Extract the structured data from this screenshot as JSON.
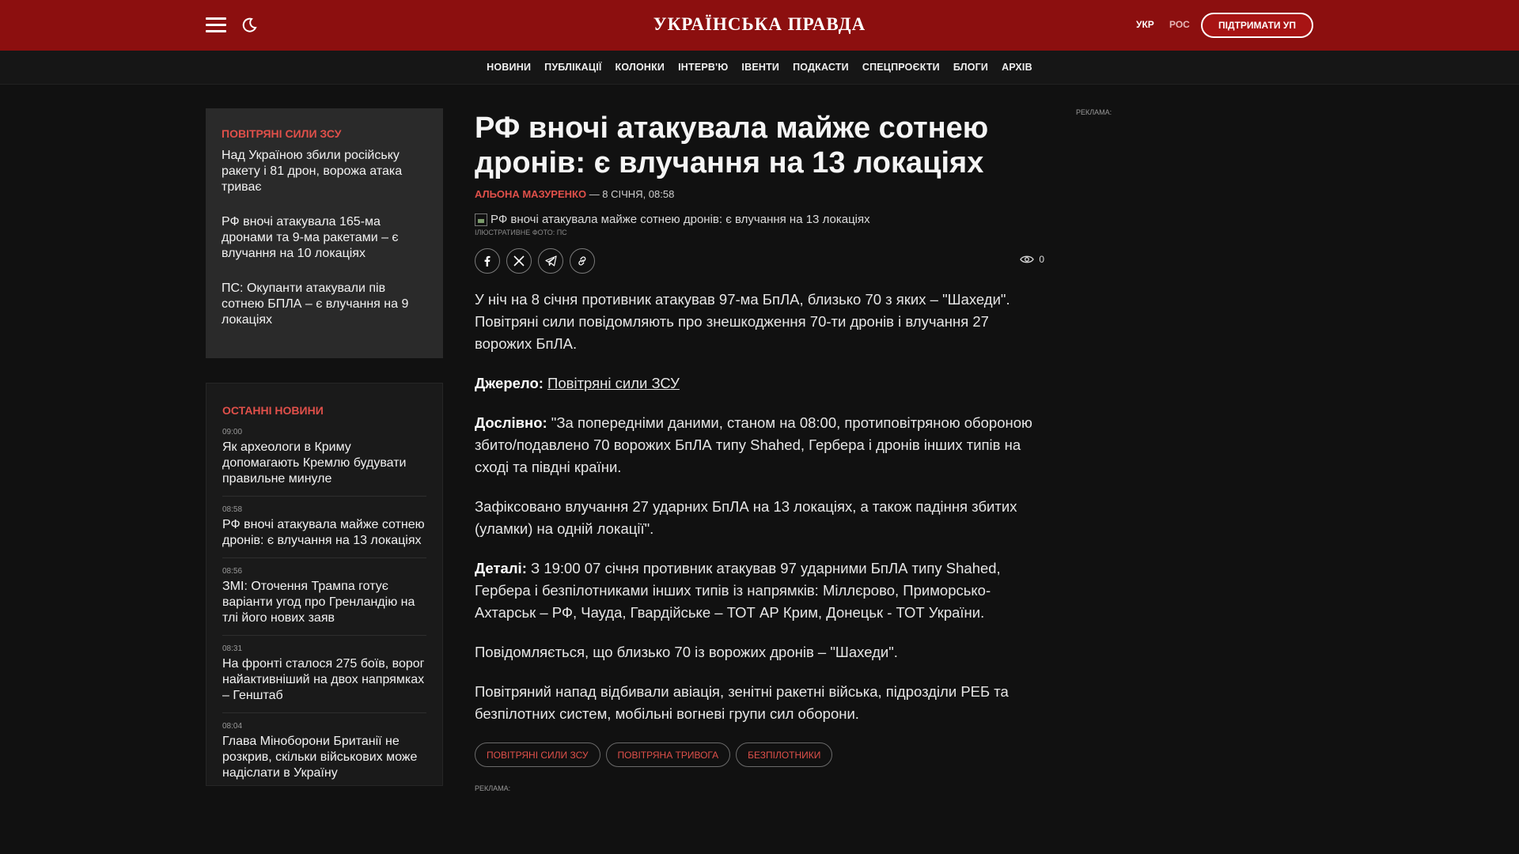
{
  "header": {
    "logo": "УКРАЇНСЬКА ПРАВДА",
    "lang_ukr": "УКР",
    "lang_ros": "РОС",
    "support": "ПІДТРИМАТИ УП"
  },
  "nav": [
    "НОВИНИ",
    "ПУБЛІКАЦІЇ",
    "КОЛОНКИ",
    "ІНТЕРВ'Ю",
    "ІВЕНТИ",
    "ПОДКАСТИ",
    "СПЕЦПРОЄКТИ",
    "БЛОГИ",
    "АРХІВ"
  ],
  "related": {
    "title": "ПОВІТРЯНІ СИЛИ ЗСУ",
    "items": [
      "Над Україною збили російську ракету і 81 дрон, ворожа атака триває",
      "РФ вночі атакувала 165-ма дронами та 9-ма ракетами – є влучання на 10 локаціях",
      "ПС: Окупанти атакували пів сотнею БПЛА – є влучання на 9 локаціях"
    ]
  },
  "latest": {
    "title": "ОСТАННІ НОВИНИ",
    "items": [
      {
        "time": "09:00",
        "title": "Як археологи в Криму допомагають Кремлю будувати правильне минуле"
      },
      {
        "time": "08:58",
        "title": "РФ вночі атакувала майже сотнею дронів: є влучання на 13 локаціях"
      },
      {
        "time": "08:56",
        "title": "ЗМІ: Оточення Трампа готує варіанти угод про Гренландію на тлі його нових заяв"
      },
      {
        "time": "08:31",
        "title": "На фронті сталося 275 боїв, ворог найактивніший на двох напрямках – Генштаб"
      },
      {
        "time": "08:04",
        "title": "Глава Міноборони Британії не розкрив, скільки військових може надіслати в Україну"
      }
    ]
  },
  "article": {
    "headline": "РФ вночі атакувала майже сотнею дронів: є влучання на 13 локаціях",
    "author": "АЛЬОНА МАЗУРЕНКО",
    "date": " — 8 СІЧНЯ, 08:58",
    "image_alt": "РФ вночі атакувала майже сотнею дронів: є влучання на 13 локаціях",
    "caption": "ІЛЮСТРАТИВНЕ ФОТО: ПС",
    "views": "0",
    "p1": "У ніч на 8 січня противник атакував 97-ма БпЛА, близько 70 з яких – \"Шахеди\". Повітряні сили повідомляють про знешкодження 70-ти дронів і влучання 27 ворожих БпЛА.",
    "source_label": "Джерело:",
    "source_link": "Повітряні сили ЗСУ",
    "quote_label": "Дослівно:",
    "quote_text": " \"За попередніми даними, станом на 08:00, протиповітряною обороною збито/подавлено 70 ворожих БпЛА типу Shahed, Гербера і дронів інших типів на сході та півдні країни.",
    "p3": "Зафіксовано влучання 27 ударних БпЛА на 13 локаціях, а також падіння збитих (уламки) на одній локації\".",
    "details_label": "Деталі:",
    "details_text": " З 19:00 07 січня противник атакував 97 ударними БпЛА типу Shahed, Гербера і безпілотниками інших типів із напрямків: Міллєрово, Приморсько-Ахтарськ – РФ, Чауда, Гвардійське – ТОТ АР Крим, Донецьк - ТОТ України.",
    "p5": "Повідомляється, що близько 70 із ворожих дронів – \"Шахеди\".",
    "p6": "Повітряний напад відбивали авіація, зенітні ракетні війська, підрозділи РЕБ та безпілотних систем, мобільні вогневі групи сил оборони.",
    "tags": [
      "ПОВІТРЯНІ СИЛИ ЗСУ",
      "ПОВІТРЯНА ТРИВОГА",
      "БЕЗПІЛОТНИКИ"
    ]
  },
  "ads": {
    "label": "РЕКЛАМА:"
  },
  "colors": {
    "brand": "#8c0f0f",
    "accent": "#e0504a"
  }
}
